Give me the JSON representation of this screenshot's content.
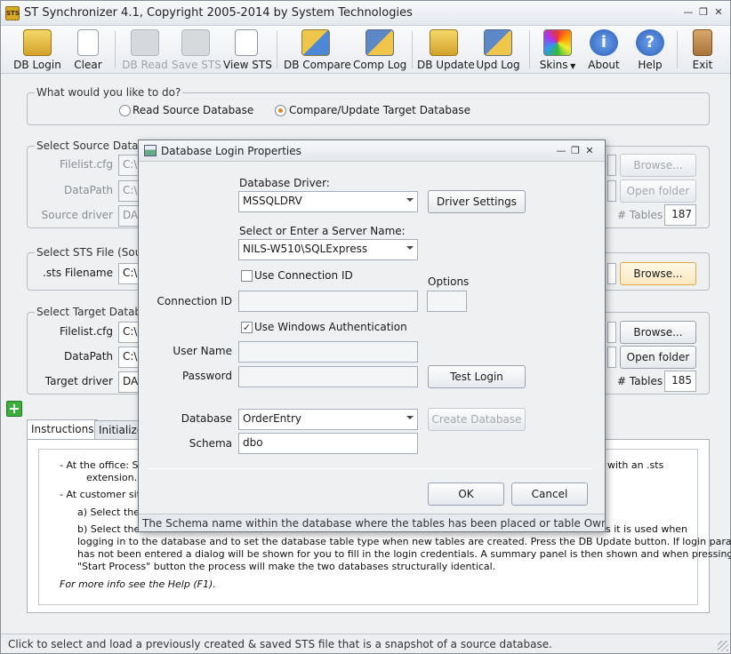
{
  "window": {
    "title": "ST Synchronizer 4.1, Copyright 2005-2014 by System Technologies",
    "app_icon": "STS"
  },
  "toolbar": {
    "db_login": "DB Login",
    "clear": "Clear",
    "db_read": "DB Read",
    "save_sts": "Save STS",
    "view_sts": "View STS",
    "db_compare": "DB Compare",
    "comp_log": "Comp Log",
    "db_update": "DB Update",
    "upd_log": "Upd Log",
    "skins": "Skins",
    "about": "About",
    "help": "Help",
    "exit": "Exit"
  },
  "mode": {
    "legend": "What would you like to do?",
    "read_source": "Read Source Database",
    "compare_update": "Compare/Update Target Database",
    "selected": "compare_update"
  },
  "source": {
    "legend": "Select Source Database",
    "filelist_label": "Filelist.cfg",
    "filelist_value": "C:\\",
    "datapath_label": "DataPath",
    "datapath_value": "C:\\",
    "driver_label": "Source driver",
    "driver_value": "DA",
    "browse": "Browse...",
    "open_folder": "Open folder",
    "tables_label": "# Tables",
    "tables_value": "187"
  },
  "sts_file": {
    "legend": "Select STS File (Source",
    "filename_label": ".sts Filename",
    "filename_value": "C:\\",
    "browse": "Browse..."
  },
  "target": {
    "legend": "Select Target Database",
    "filelist_label": "Filelist.cfg",
    "filelist_value": "C:\\",
    "datapath_label": "DataPath",
    "datapath_value": "C:\\",
    "driver_label": "Target driver",
    "driver_value": "DA",
    "browse": "Browse...",
    "open_folder": "Open folder",
    "tables_label": "# Tables",
    "tables_value": "185"
  },
  "tabs": {
    "instructions": "Instructions",
    "initialize": "Initialize"
  },
  "instructions": {
    "line1a": "- At the office: Sel",
    "line1b": "with an .sts",
    "line2": "extension.",
    "line3": "- At customer site;",
    "line4": "a) Select the .s",
    "line5a": "b) Select the T",
    "line5b": "s it is used when",
    "line6": "logging in to the database and to set the database table type when new tables are created. Press the DB Update button. If login parameters",
    "line7": "has not been entered a dialog will be shown for you to fill in the login credentials. A summary panel is then shown and when pressing the",
    "line8": "\"Start Process\" button the process will make the two databases structurally identical.",
    "line9": "For more info see the Help (F1)."
  },
  "status_bar": "Click to select and load a previously created & saved STS file that is a snapshot of a source database.",
  "dialog": {
    "title": "Database Login Properties",
    "driver_label": "Database Driver:",
    "driver_value": "MSSQLDRV",
    "driver_settings": "Driver Settings",
    "server_label": "Select or Enter a Server Name:",
    "server_value": "NILS-W510\\SQLExpress",
    "use_connection_id": "Use Connection ID",
    "use_connection_id_checked": false,
    "options_label": "Options",
    "connection_id_label": "Connection ID",
    "connection_id_value": "",
    "use_windows_auth": "Use Windows Authentication",
    "use_windows_auth_checked": true,
    "user_name_label": "User Name",
    "user_name_value": "",
    "password_label": "Password",
    "password_value": "",
    "test_login": "Test Login",
    "database_label": "Database",
    "database_value": "OrderEntry",
    "create_database": "Create Database",
    "schema_label": "Schema",
    "schema_value": "dbo",
    "ok": "OK",
    "cancel": "Cancel",
    "status": "The Schema name within the database where the tables has been placed or table Owner name"
  }
}
